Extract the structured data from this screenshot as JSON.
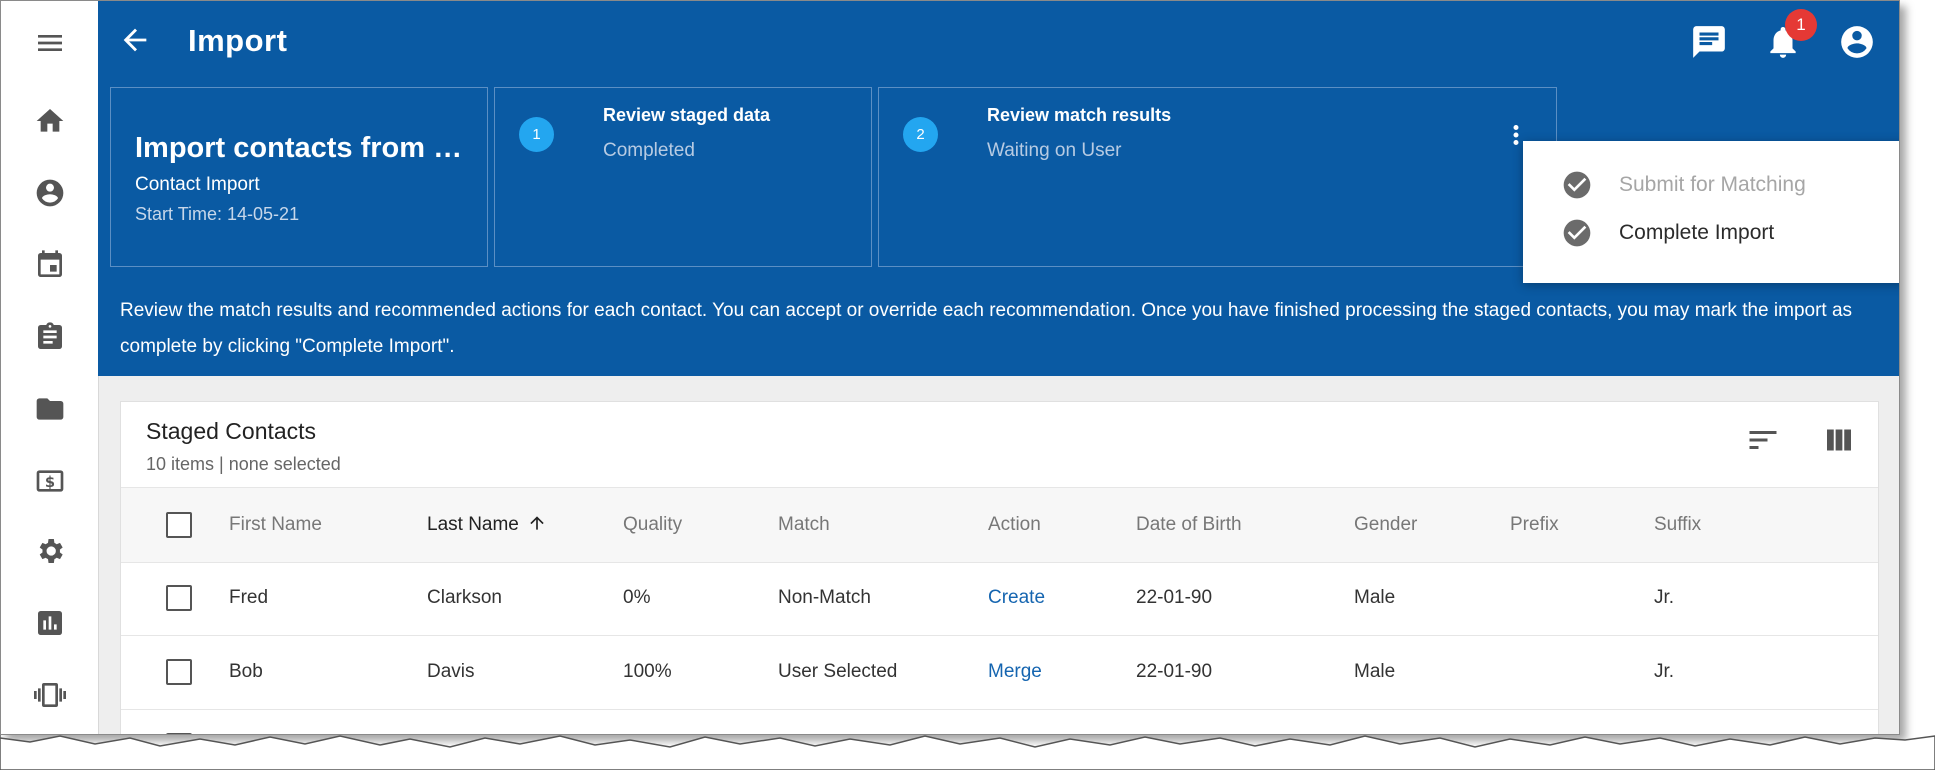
{
  "app": {
    "title": "Import",
    "notification_count": "1"
  },
  "rail": {
    "items": [
      "menu-icon",
      "home-icon",
      "account-icon",
      "calendar-icon",
      "clipboard-icon",
      "folder-icon",
      "billing-icon",
      "settings-icon",
      "chart-icon",
      "vibration-icon"
    ]
  },
  "import_card": {
    "title": "Import contacts from …",
    "subtitle": "Contact Import",
    "start_time": "Start Time: 14-05-21"
  },
  "steps": [
    {
      "number": "1",
      "title": "Review staged data",
      "status": "Completed"
    },
    {
      "number": "2",
      "title": "Review match results",
      "status": "Waiting on User"
    }
  ],
  "description": "Review the match results and recommended actions for each contact. You can accept or override each recommendation. Once you have finished processing the staged contacts, you may mark the import as complete by clicking \"Complete Import\".",
  "menu": {
    "items": [
      {
        "label": "Submit for Matching",
        "disabled": true
      },
      {
        "label": "Complete Import",
        "disabled": false
      }
    ]
  },
  "table": {
    "title": "Staged Contacts",
    "summary": "10 items | none selected",
    "columns": [
      "First Name",
      "Last Name",
      "Quality",
      "Match",
      "Action",
      "Date of Birth",
      "Gender",
      "Prefix",
      "Suffix"
    ],
    "sorted_column": "Last Name",
    "rows": [
      {
        "first": "Fred",
        "last": "Clarkson",
        "quality": "0%",
        "match": "Non-Match",
        "action": "Create",
        "dob": "22-01-90",
        "gender": "Male",
        "prefix": "",
        "suffix": "Jr."
      },
      {
        "first": "Bob",
        "last": "Davis",
        "quality": "100%",
        "match": "User Selected",
        "action": "Merge",
        "dob": "22-01-90",
        "gender": "Male",
        "prefix": "",
        "suffix": "Jr."
      }
    ]
  },
  "colors": {
    "primary": "#0a5aa3",
    "step_circle": "#23a6f0",
    "badge": "#e53935",
    "link": "#1565b0"
  }
}
